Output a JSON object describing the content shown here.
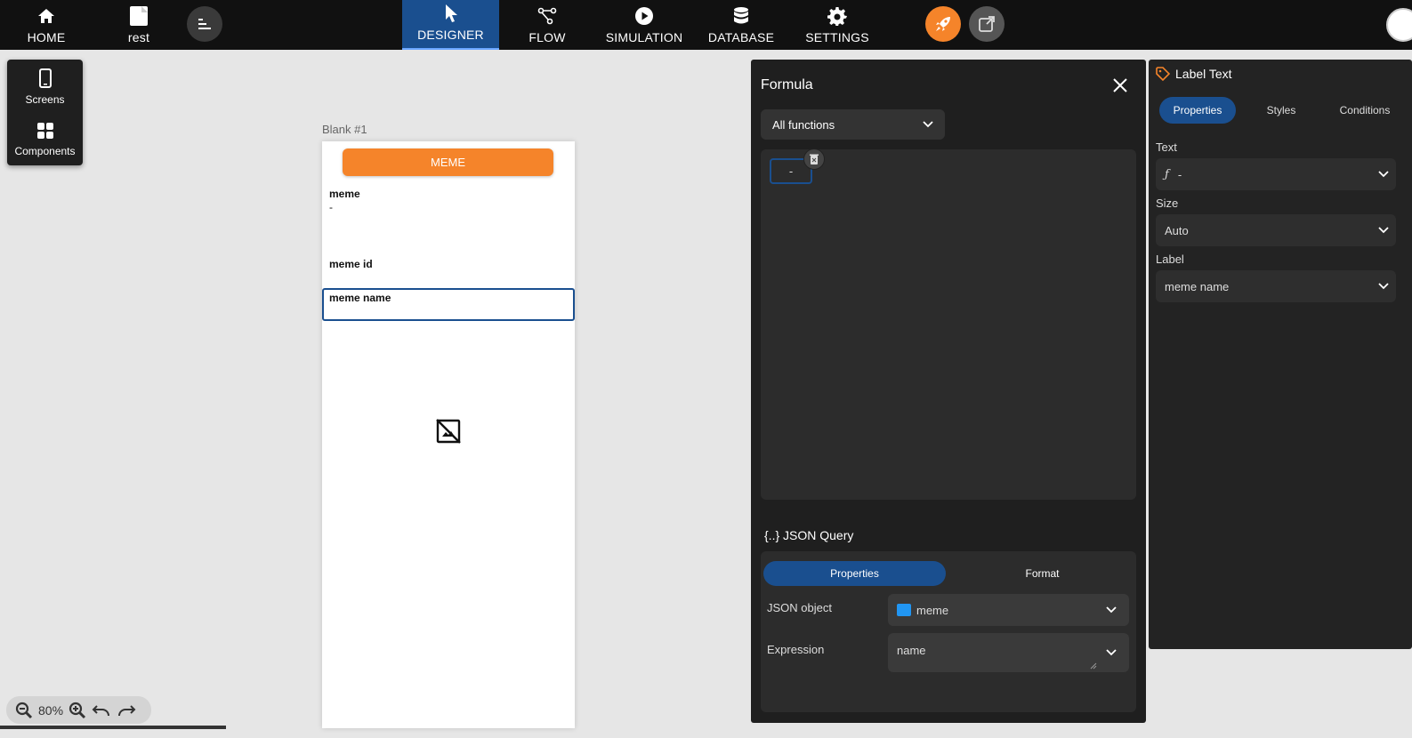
{
  "topbar": {
    "home_label": "HOME",
    "project_label": "rest",
    "designer_label": "DESIGNER",
    "flow_label": "FLOW",
    "simulation_label": "SIMULATION",
    "database_label": "DATABASE",
    "settings_label": "SETTINGS",
    "accent_publish": "#f5842a",
    "accent_active": "#1a4f8f"
  },
  "palette": {
    "screens_label": "Screens",
    "components_label": "Components"
  },
  "canvas": {
    "screen_name": "Blank #1",
    "button_label": "MEME",
    "label1_title": "meme",
    "label1_value": "-",
    "label2_title": "meme id",
    "label3_title": "meme name",
    "image_icon": "broken-image-icon"
  },
  "formula": {
    "title": "Formula",
    "functions_select": "All functions",
    "token_value": "-",
    "json_query_title": "{..} JSON Query",
    "tabs": [
      "Properties",
      "Format"
    ],
    "json_object_label": "JSON object",
    "json_object_value": "meme",
    "json_object_color": "#2196f3",
    "expression_label": "Expression",
    "expression_value": "name"
  },
  "properties": {
    "title": "Label Text",
    "tabs": [
      "Properties",
      "Styles",
      "Conditions"
    ],
    "text_label": "Text",
    "text_value": "-",
    "size_label": "Size",
    "size_value": "Auto",
    "label_label": "Label",
    "label_value": "meme name"
  },
  "zoom": {
    "level": "80%"
  }
}
